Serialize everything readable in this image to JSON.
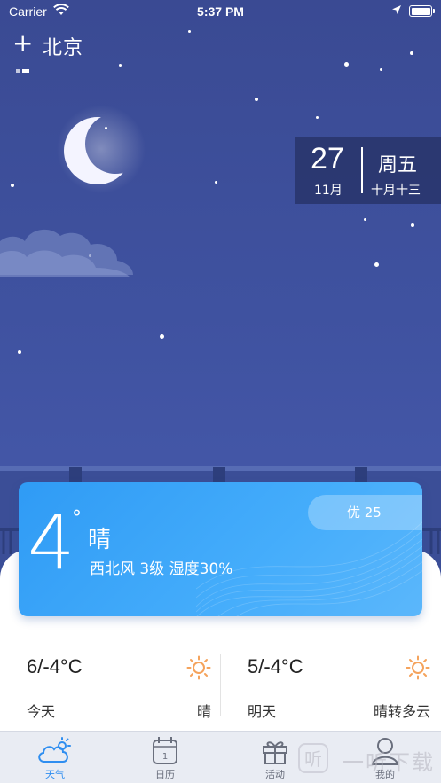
{
  "status_bar": {
    "carrier": "Carrier",
    "time": "5:37 PM"
  },
  "header": {
    "add_icon": "plus-icon",
    "city": "北京",
    "add_symbol": "+"
  },
  "date_box": {
    "day": "27",
    "month": "11月",
    "weekday": "周五",
    "lunar": "十月十三"
  },
  "current": {
    "temperature": "4",
    "degree_symbol": "°",
    "condition": "晴",
    "wind_humidity": "西北风 3级  湿度30%",
    "aqi": "优 25"
  },
  "forecast": [
    {
      "label": "今天",
      "range": "6/-4°C",
      "condition": "晴",
      "icon": "sun-icon"
    },
    {
      "label": "明天",
      "range": "5/-4°C",
      "condition": "晴转多云",
      "icon": "sun-icon"
    }
  ],
  "tabs": [
    {
      "label": "天气",
      "icon": "weather-cloud-icon",
      "active": true
    },
    {
      "label": "日历",
      "icon": "calendar-icon",
      "calendar_day": "1",
      "active": false
    },
    {
      "label": "活动",
      "icon": "gift-icon",
      "active": false
    },
    {
      "label": "我的",
      "icon": "user-icon",
      "active": false
    }
  ],
  "watermark": {
    "text": "一听下载",
    "icon_text": "听"
  },
  "colors": {
    "sky": "#3e4f94",
    "card": "#3aa4f8",
    "accent": "#2f8ef0",
    "sun": "#f5a35c"
  }
}
